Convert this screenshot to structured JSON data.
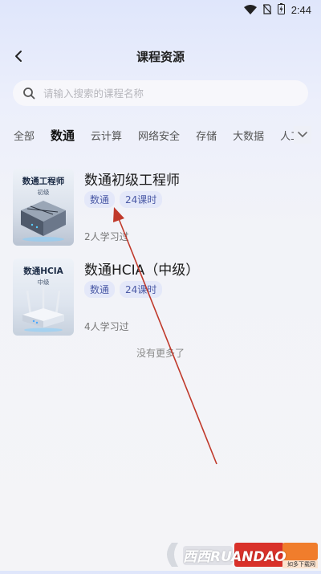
{
  "status_bar": {
    "time": "2:44",
    "icons": [
      "wifi-icon",
      "no-sim-icon",
      "battery-charging-icon"
    ]
  },
  "header": {
    "title": "课程资源",
    "back_icon": "chevron-left-icon"
  },
  "search": {
    "placeholder": "请输入搜索的课程名称",
    "icon": "search-icon"
  },
  "tabs": {
    "items": [
      {
        "label": "全部",
        "active": false
      },
      {
        "label": "数通",
        "active": true
      },
      {
        "label": "云计算",
        "active": false
      },
      {
        "label": "网络安全",
        "active": false
      },
      {
        "label": "存储",
        "active": false
      },
      {
        "label": "大数据",
        "active": false
      },
      {
        "label": "人工",
        "active": false
      }
    ],
    "more_icon": "chevron-down-icon"
  },
  "courses": [
    {
      "thumb_title": "数通工程师",
      "thumb_sub": "初级",
      "title": "数通初级工程师",
      "tags": [
        "数通",
        "24课时"
      ],
      "learners": "2人学习过"
    },
    {
      "thumb_title": "数通HCIA",
      "thumb_sub": "中级",
      "title": "数通HCIA（中级）",
      "tags": [
        "数通",
        "24课时"
      ],
      "learners": "4人学习过"
    }
  ],
  "footer": {
    "no_more": "没有更多了"
  },
  "watermark": {
    "text": "西西RUANDAO",
    "sub": "如多下载网"
  },
  "colors": {
    "accent": "#4b5aa6",
    "annotation_arrow": "#c0392b",
    "tag_bg": "#e4e8f9"
  }
}
